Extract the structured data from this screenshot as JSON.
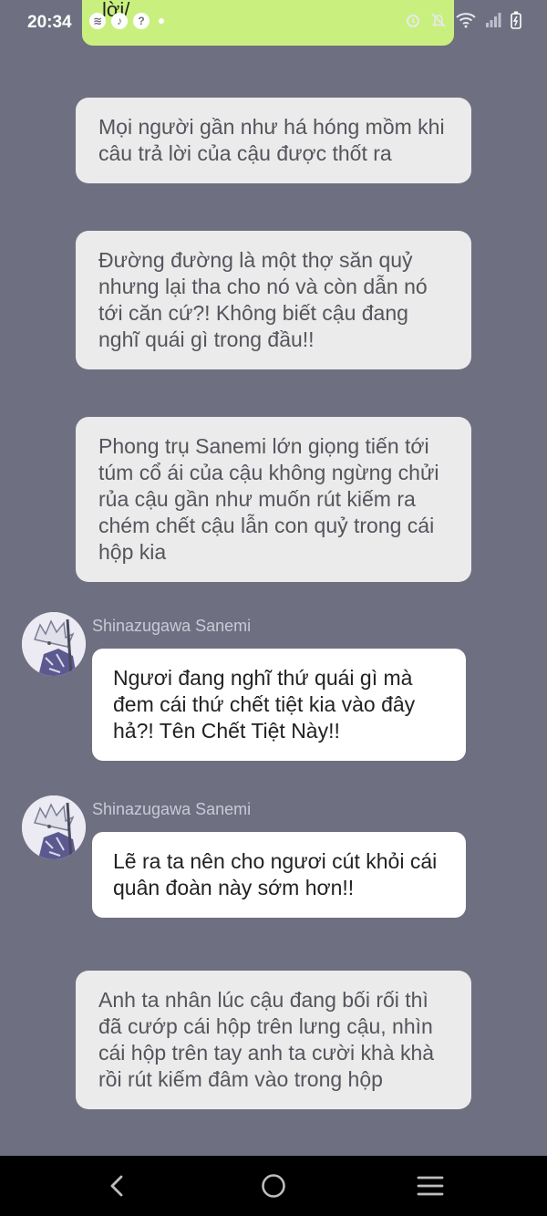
{
  "status_bar": {
    "time": "20:34",
    "left_icons": [
      "spotify-icon",
      "music-icon",
      "help-icon"
    ],
    "right_icons": [
      "alarm-icon",
      "mute-icon",
      "wifi-icon",
      "signal-icon",
      "battery-icon"
    ]
  },
  "top_bubble": {
    "text": "lời/"
  },
  "messages": [
    {
      "type": "narration",
      "text": "Mọi người gần như há hóng mồm khi câu trả lời của cậu được thốt ra"
    },
    {
      "type": "narration",
      "text": "Đường đường là một thợ săn quỷ nhưng lại tha cho nó và còn dẫn nó tới căn cứ?! Không biết cậu đang nghĩ quái gì trong đầu!!"
    },
    {
      "type": "narration",
      "text": "Phong trụ Sanemi lớn giọng tiến tới túm cổ ái của cậu không ngừng chửi rủa cậu gần như muốn rút kiếm ra chém chết cậu lẫn con quỷ trong cái hộp kia"
    },
    {
      "type": "speech",
      "speaker": "Shinazugawa Sanemi",
      "text": "Ngươi đang nghĩ thứ quái gì mà đem cái thứ chết tiệt kia vào đây hả?! Tên Chết Tiệt Này!!"
    },
    {
      "type": "speech",
      "speaker": "Shinazugawa Sanemi",
      "text": "Lẽ ra ta nên cho ngươi cút khỏi cái quân đoàn này sớm hơn!!"
    },
    {
      "type": "narration",
      "text": "Anh ta nhân lúc cậu đang bối rối thì đã cướp cái hộp trên lưng cậu, nhìn cái hộp trên tay anh ta cười khà khà rồi rút kiếm đâm vào trong hộp"
    }
  ],
  "nav_bar": {
    "buttons": [
      "back-icon",
      "home-icon",
      "menu-icon"
    ]
  },
  "colors": {
    "background": "#6e6f80",
    "narration_bubble": "#ebebeb",
    "speech_bubble": "#ffffff",
    "top_bubble": "#c9f07e",
    "speaker_name": "#c9cad6"
  }
}
